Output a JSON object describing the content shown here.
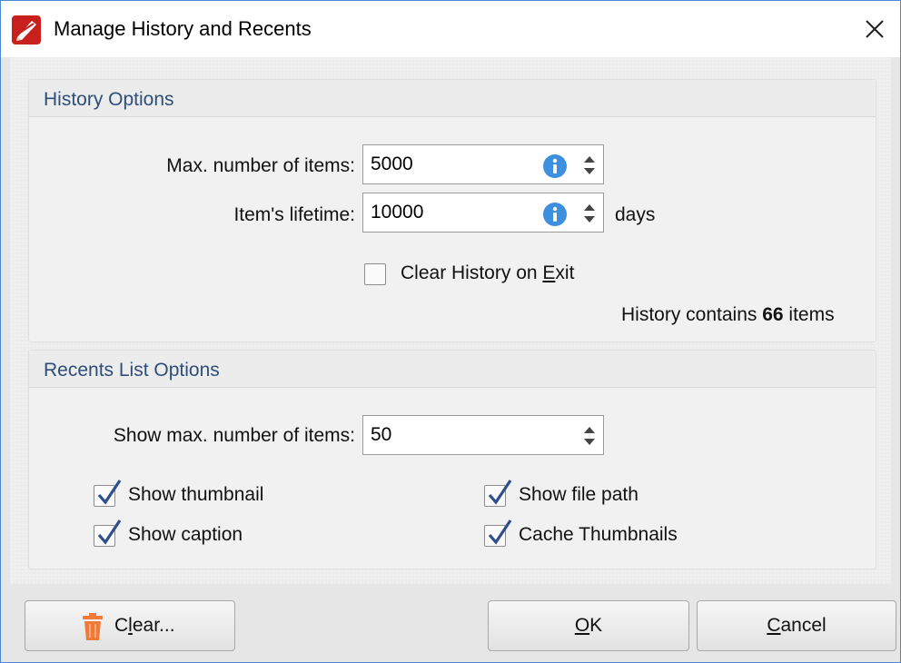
{
  "window": {
    "title": "Manage History and Recents"
  },
  "history": {
    "group_title": "History Options",
    "max_items_label": "Max. number of items:",
    "max_items_value": "5000",
    "lifetime_label": "Item's lifetime:",
    "lifetime_value": "10000",
    "lifetime_unit": "days",
    "clear_on_exit": {
      "label_pre": "Clear History on ",
      "label_accel": "E",
      "label_post": "xit",
      "checked": false
    },
    "count_pre": "History contains ",
    "count_value": "66",
    "count_post": " items"
  },
  "recents": {
    "group_title": "Recents List Options",
    "max_items_label": "Show max. number of items:",
    "max_items_value": "50",
    "options": [
      {
        "label": "Show thumbnail",
        "checked": true
      },
      {
        "label": "Show caption",
        "checked": true
      },
      {
        "label": "Show file path",
        "checked": true
      },
      {
        "label": "Cache Thumbnails",
        "checked": true
      }
    ]
  },
  "buttons": {
    "clear": {
      "accel": "l",
      "pre": "C",
      "post": "ear..."
    },
    "ok": {
      "accel": "O",
      "post": "K"
    },
    "cancel": {
      "accel": "C",
      "post": "ancel"
    }
  },
  "icons": {
    "app": "pdf-editor-app-icon",
    "close": "close-icon",
    "info": "info-icon",
    "spinner": "spinner-arrows-icon",
    "trash": "trash-icon",
    "check": "checkmark-icon"
  },
  "colors": {
    "accent_blue": "#3d8fe0",
    "group_title": "#2d4e7a",
    "trash_orange": "#f07a3a",
    "checkmark": "#2f4f8a",
    "window_border": "#4a88d4"
  }
}
